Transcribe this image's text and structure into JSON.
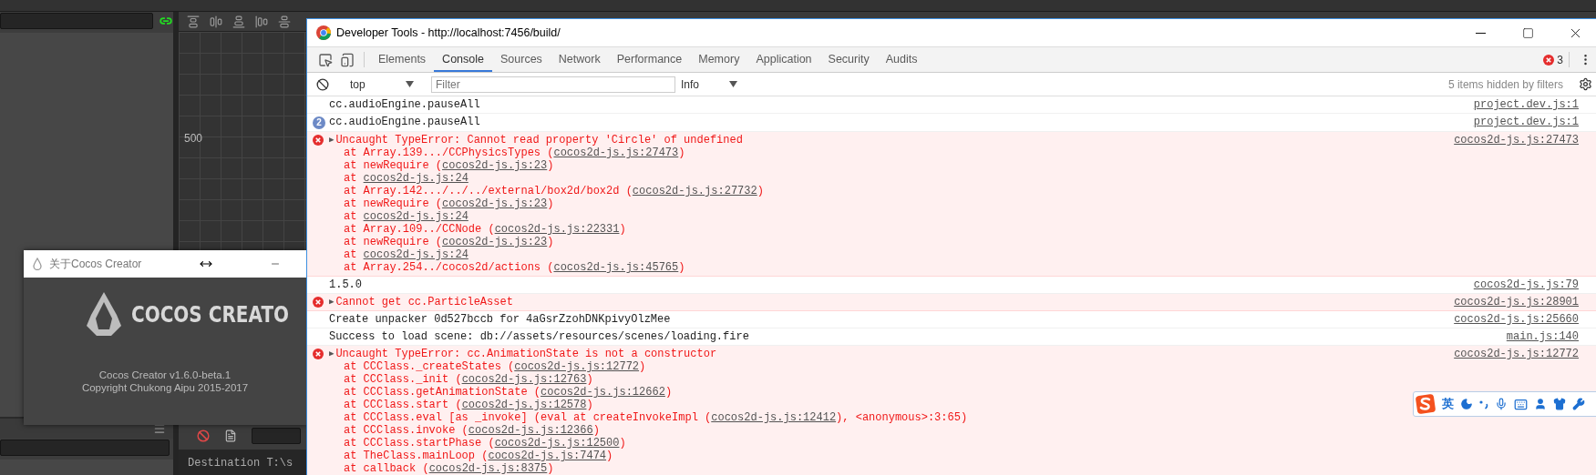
{
  "editor": {
    "ruler_label": "500",
    "output_line": "Destination T:\\s"
  },
  "about_dialog": {
    "title": "关于Cocos Creator",
    "logo_text": "COCOS CREATO",
    "version": "Cocos Creator v1.6.0-beta.1",
    "copyright": "Copyright Chukong Aipu 2015-2017"
  },
  "devtools": {
    "title": "Developer Tools - http://localhost:7456/build/",
    "tabs": [
      {
        "label": "Elements",
        "selected": false
      },
      {
        "label": "Console",
        "selected": true
      },
      {
        "label": "Sources",
        "selected": false
      },
      {
        "label": "Network",
        "selected": false
      },
      {
        "label": "Performance",
        "selected": false
      },
      {
        "label": "Memory",
        "selected": false
      },
      {
        "label": "Application",
        "selected": false
      },
      {
        "label": "Security",
        "selected": false
      },
      {
        "label": "Audits",
        "selected": false
      }
    ],
    "error_count": "3",
    "context": "top",
    "filter_placeholder": "Filter",
    "level": "Info",
    "hidden_note": "5 items hidden by filters",
    "messages": [
      {
        "kind": "log",
        "text": "cc.audioEngine.pauseAll",
        "source": "project.dev.js:1"
      },
      {
        "kind": "log",
        "count": "2",
        "text": "cc.audioEngine.pauseAll",
        "source": "project.dev.js:1"
      },
      {
        "kind": "error",
        "toggle": "▶",
        "text": "Uncaught TypeError: Cannot read property 'Circle' of undefined",
        "source": "cocos2d-js.js:27473",
        "stack": [
          {
            "before": "at Array.139.../CCPhysicsTypes (",
            "link": "cocos2d-js.js:27473",
            "after": ")"
          },
          {
            "before": "at newRequire (",
            "link": "cocos2d-js.js:23",
            "after": ")"
          },
          {
            "before": "at ",
            "link": "cocos2d-js.js:24"
          },
          {
            "before": "at Array.142.../../../external/box2d/box2d (",
            "link": "cocos2d-js.js:27732",
            "after": ")"
          },
          {
            "before": "at newRequire (",
            "link": "cocos2d-js.js:23",
            "after": ")"
          },
          {
            "before": "at ",
            "link": "cocos2d-js.js:24"
          },
          {
            "before": "at Array.109../CCNode (",
            "link": "cocos2d-js.js:22331",
            "after": ")"
          },
          {
            "before": "at newRequire (",
            "link": "cocos2d-js.js:23",
            "after": ")"
          },
          {
            "before": "at ",
            "link": "cocos2d-js.js:24"
          },
          {
            "before": "at Array.254../cocos2d/actions (",
            "link": "cocos2d-js.js:45765",
            "after": ")"
          }
        ]
      },
      {
        "kind": "log",
        "text": "1.5.0",
        "source": "cocos2d-js.js:79"
      },
      {
        "kind": "error",
        "toggle": "▶",
        "text": "Cannot get cc.ParticleAsset",
        "source": "cocos2d-js.js:28901"
      },
      {
        "kind": "log",
        "text": "Create unpacker 0d527bccb for 4aGsrZzohDNKpivyOlzMee",
        "source": "cocos2d-js.js:25660"
      },
      {
        "kind": "log",
        "text": "Success to load scene: db://assets/resources/scenes/loading.fire",
        "source": "main.js:140"
      },
      {
        "kind": "error",
        "toggle": "▶",
        "text": "Uncaught TypeError: cc.AnimationState is not a constructor",
        "source": "cocos2d-js.js:12772",
        "stack": [
          {
            "before": "at CCClass._createStates (",
            "link": "cocos2d-js.js:12772",
            "after": ")"
          },
          {
            "before": "at CCClass._init (",
            "link": "cocos2d-js.js:12763",
            "after": ")"
          },
          {
            "before": "at CCClass.getAnimationState (",
            "link": "cocos2d-js.js:12662",
            "after": ")"
          },
          {
            "before": "at CCClass.start (",
            "link": "cocos2d-js.js:12578",
            "after": ")"
          },
          {
            "before": "at CCClass.eval [as _invoke] (eval at createInvokeImpl (",
            "link": "cocos2d-js.js:12412",
            "after": "), <anonymous>:3:65)"
          },
          {
            "before": "at CCClass.invoke (",
            "link": "cocos2d-js.js:12366",
            "after": ")"
          },
          {
            "before": "at CCClass.startPhase (",
            "link": "cocos2d-js.js:12500",
            "after": ")"
          },
          {
            "before": "at TheClass.mainLoop (",
            "link": "cocos2d-js.js:7474",
            "after": ")"
          },
          {
            "before": "at callback (",
            "link": "cocos2d-js.js:8375",
            "after": ")"
          }
        ]
      }
    ]
  },
  "ime_bar": {
    "language": "英"
  }
}
